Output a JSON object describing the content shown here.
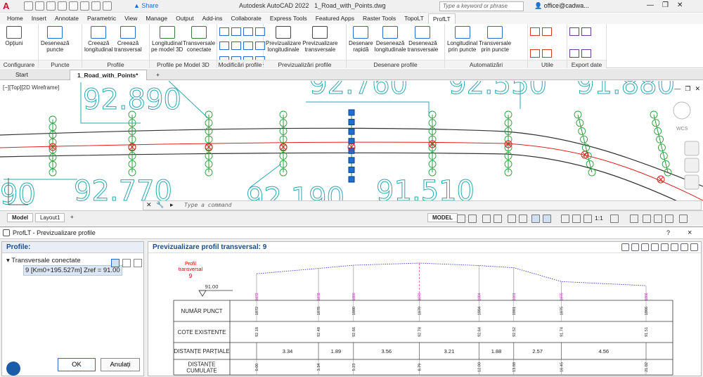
{
  "app": {
    "title": "Autodesk AutoCAD 2022",
    "file": "1_Road_with_Points.dwg",
    "share": "Share",
    "search_placeholder": "Type a keyword or phrase",
    "user": "office@cadwa..."
  },
  "menu_tabs": [
    "Home",
    "Insert",
    "Annotate",
    "Parametric",
    "View",
    "Manage",
    "Output",
    "Add-ins",
    "Collaborate",
    "Express Tools",
    "Featured Apps",
    "Raster Tools",
    "TopoLT",
    "ProfLT"
  ],
  "active_tab": "ProfLT",
  "ribbon": {
    "panels": [
      {
        "label": "Configurare",
        "buttons": [
          "Opțiuni"
        ]
      },
      {
        "label": "Puncte",
        "buttons": [
          "Desenează\npuncte"
        ]
      },
      {
        "label": "Profile",
        "buttons": [
          "Creează\nlongitudinal",
          "Creează\ntransversal"
        ]
      },
      {
        "label": "Profile pe Model 3D",
        "buttons": [
          "Longitudinal\npe model 3D",
          "Transversale\nconectate"
        ]
      },
      {
        "label": "Modificări profile",
        "buttons": []
      },
      {
        "label": "Previzualizări profile",
        "buttons": [
          "Previzualizare\nlongitudinale",
          "Previzualizare\ntransversale"
        ]
      },
      {
        "label": "Desenare profile",
        "buttons": [
          "Desenare\nrapidă",
          "Desenează\nlongitudinale",
          "Desenează\ntransversale"
        ]
      },
      {
        "label": "Automatizări",
        "buttons": [
          "Longitudinal\nprin puncte",
          "Transversale\nprin puncte"
        ]
      },
      {
        "label": "Utile",
        "buttons": []
      },
      {
        "label": "Export date",
        "buttons": []
      }
    ]
  },
  "doc_tabs": [
    "Start",
    "1_Road_with_Points*"
  ],
  "viewport_label": "[−][Top][2D Wireframe]",
  "wcs": "WCS",
  "canvas_numbers": [
    "92.890",
    "92.760",
    "92.550",
    "91.880",
    "92.770",
    "92.190",
    "91.510",
    "90"
  ],
  "command_placeholder": "Type a command",
  "layout_tabs": [
    "Model",
    "Layout1"
  ],
  "status": {
    "model": "MODEL",
    "scale": "1:1"
  },
  "dialog": {
    "title": "ProfLT - Previzualizare profile",
    "left_header": "Profile:",
    "tree_root": "Transversale conectate",
    "tree_item": "9 [Km0+195.527m] Zref = 91.00",
    "ok": "OK",
    "cancel": "Anulați",
    "right_header": "Previzualizare profil transversal: 9",
    "help": "?",
    "close": "×"
  },
  "chart_data": {
    "type": "table",
    "profile_label": "Profil\ntransversal",
    "profile_number": "9",
    "ref_level": "91.00",
    "row_headers": [
      "NUMĂR PUNCT",
      "COTE EXISTENTE",
      "DISTANȚE PARȚIALE",
      "DISTANȚE\nCUMULATE"
    ],
    "points": [
      {
        "id": "1872",
        "elev": "92.18",
        "cum": "0.00"
      },
      {
        "id": "1878",
        "elev": "92.48",
        "cum": "3.34"
      },
      {
        "id": "1880",
        "elev": "92.66",
        "cum": "5.23"
      },
      {
        "id": "1879",
        "elev": "92.78",
        "cum": "8.79"
      },
      {
        "id": "1884",
        "elev": "92.64",
        "cum": "12.00"
      },
      {
        "id": "1001",
        "elev": "92.52",
        "cum": "13.88"
      },
      {
        "id": "1875",
        "elev": "91.74",
        "cum": "16.45"
      },
      {
        "id": "1866",
        "elev": "91.51",
        "cum": "21.02"
      }
    ],
    "partials": [
      "3.34",
      "1.89",
      "3.56",
      "3.21",
      "1.88",
      "2.57",
      "4.56"
    ]
  }
}
